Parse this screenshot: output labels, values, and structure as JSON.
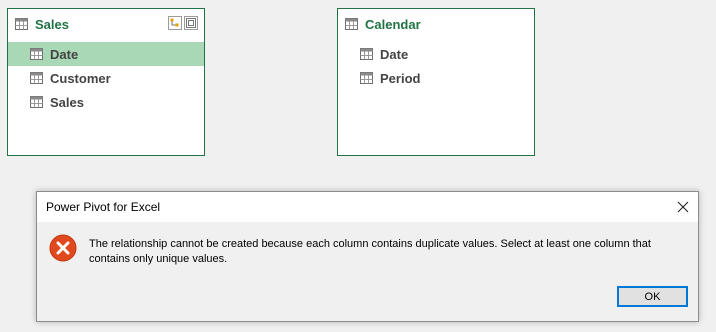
{
  "tables": [
    {
      "title": "Sales",
      "fields": [
        {
          "label": "Date",
          "selected": true
        },
        {
          "label": "Customer",
          "selected": false
        },
        {
          "label": "Sales",
          "selected": false
        }
      ]
    },
    {
      "title": "Calendar",
      "fields": [
        {
          "label": "Date",
          "selected": false
        },
        {
          "label": "Period",
          "selected": false
        }
      ]
    }
  ],
  "dialog": {
    "title": "Power Pivot for Excel",
    "message": "The relationship cannot be created because each column contains duplicate values. Select at least one column that contains only unique values.",
    "ok_label": "OK"
  },
  "colors": {
    "accent_green": "#217346",
    "selected_row": "#a9d8b6",
    "error_red": "#e0491d",
    "ok_border": "#0078d7"
  },
  "icons": {
    "table_header": "table-icon",
    "field": "column-icon",
    "header_actions": [
      "hierarchy-icon",
      "maximize-icon"
    ],
    "dialog_close": "close-icon",
    "dialog_error": "error-icon"
  }
}
